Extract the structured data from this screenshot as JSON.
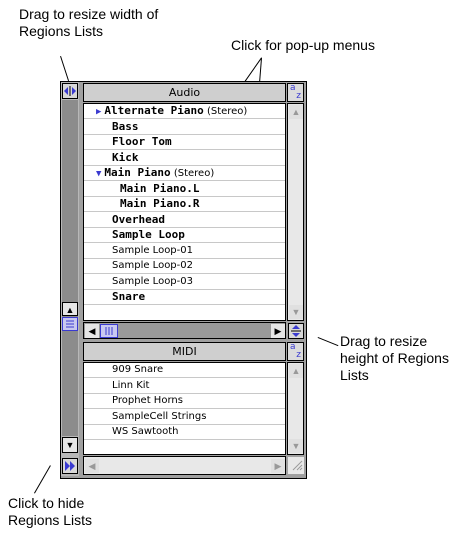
{
  "callouts": {
    "resize_width": "Drag to resize width of\nRegions Lists",
    "popup_menus": "Click for pop-up menus",
    "resize_height": "Drag to resize\nheight of Regions\nLists",
    "hide_lists": "Click to hide\nRegions Lists"
  },
  "audio_list": {
    "header": "Audio",
    "rows": [
      {
        "text": "Alternate Piano",
        "suffix": " (Stereo)",
        "bold": true,
        "indent": 1,
        "marker": "▶"
      },
      {
        "text": "Bass",
        "suffix": "",
        "bold": true,
        "indent": 0,
        "marker": ""
      },
      {
        "text": "Floor Tom",
        "suffix": "",
        "bold": true,
        "indent": 0,
        "marker": ""
      },
      {
        "text": "Kick",
        "suffix": "",
        "bold": true,
        "indent": 0,
        "marker": ""
      },
      {
        "text": "Main Piano",
        "suffix": " (Stereo)",
        "bold": true,
        "indent": 1,
        "marker": "▼"
      },
      {
        "text": "Main Piano.L",
        "suffix": "",
        "bold": true,
        "indent": 2,
        "marker": ""
      },
      {
        "text": "Main Piano.R",
        "suffix": "",
        "bold": true,
        "indent": 2,
        "marker": ""
      },
      {
        "text": "Overhead",
        "suffix": "",
        "bold": true,
        "indent": 0,
        "marker": ""
      },
      {
        "text": "Sample Loop",
        "suffix": "",
        "bold": true,
        "indent": 0,
        "marker": ""
      },
      {
        "text": "Sample Loop-01",
        "suffix": "",
        "bold": false,
        "indent": 0,
        "marker": ""
      },
      {
        "text": "Sample Loop-02",
        "suffix": "",
        "bold": false,
        "indent": 0,
        "marker": ""
      },
      {
        "text": "Sample Loop-03",
        "suffix": "",
        "bold": false,
        "indent": 0,
        "marker": ""
      },
      {
        "text": "Snare",
        "suffix": "",
        "bold": true,
        "indent": 0,
        "marker": ""
      }
    ]
  },
  "midi_list": {
    "header": "MIDI",
    "rows": [
      {
        "text": "909 Snare"
      },
      {
        "text": "Linn Kit"
      },
      {
        "text": "Prophet Horns"
      },
      {
        "text": "SampleCell Strings"
      },
      {
        "text": "WS Sawtooth"
      }
    ]
  },
  "sort_button": {
    "a": "a",
    "z": "z"
  },
  "colors": {
    "accent": "#3a3ad0",
    "frame": "#a0a0a0"
  }
}
